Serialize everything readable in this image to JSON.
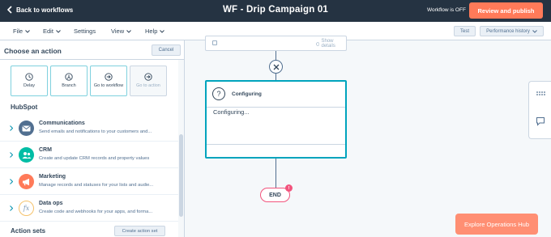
{
  "topbar": {
    "back_label": "Back to workflows",
    "title": "WF - Drip Campaign 01",
    "status": "Workflow is OFF",
    "publish_label": "Review and publish"
  },
  "menubar": {
    "items": [
      "File",
      "Edit",
      "Settings",
      "View",
      "Help"
    ],
    "test_label": "Test",
    "performance_label": "Performance history"
  },
  "panel": {
    "title": "Choose an action",
    "cancel_label": "Cancel",
    "tiles": [
      {
        "label": "Delay",
        "icon": "clock-icon",
        "disabled": false
      },
      {
        "label": "Branch",
        "icon": "branch-icon",
        "disabled": false
      },
      {
        "label": "Go to workflow",
        "icon": "arrow-right-circle-icon",
        "disabled": false
      },
      {
        "label": "Go to action",
        "icon": "arrow-right-circle-icon",
        "disabled": true
      }
    ],
    "section_title": "HubSpot",
    "categories": [
      {
        "title": "Communications",
        "desc": "Send emails and notifications to your customers and...",
        "icon": "envelope-icon",
        "color": "#516f90"
      },
      {
        "title": "CRM",
        "desc": "Create and update CRM records and property values",
        "icon": "people-icon",
        "color": "#00bda5"
      },
      {
        "title": "Marketing",
        "desc": "Manage records and statuses for your lists and audie...",
        "icon": "megaphone-icon",
        "color": "#ff7a59"
      },
      {
        "title": "Data ops",
        "desc": "Create code and webhooks for your apps, and forma...",
        "icon": "function-icon",
        "color": "#f5c26b"
      }
    ],
    "action_sets_title": "Action sets",
    "create_action_set_label": "Create action set"
  },
  "canvas": {
    "show_details_label": "Show details",
    "configuring_title": "Configuring",
    "configuring_body": "Configuring...",
    "end_label": "END",
    "end_badge": "!",
    "explore_label": "Explore Operations Hub"
  },
  "colors": {
    "topbar_bg": "#253342",
    "accent_orange": "#ff7a59",
    "accent_teal": "#00a4bd",
    "end_pink": "#f2547d"
  }
}
